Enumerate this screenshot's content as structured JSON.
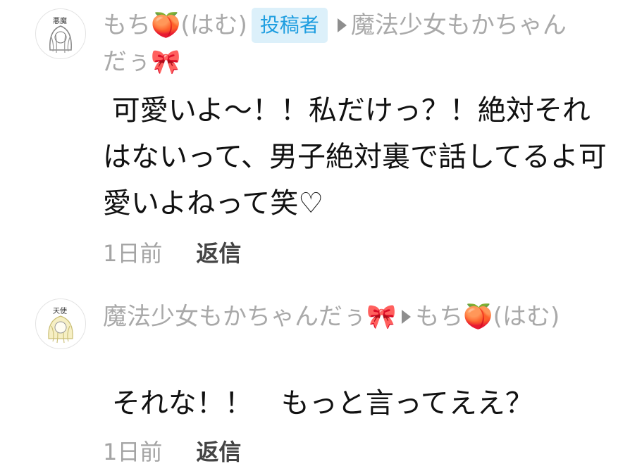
{
  "comments": [
    {
      "author": "もち🍑(はむ)",
      "badge": "投稿者",
      "reply_to": "魔法少女もかちゃんだぅ🎀",
      "avatar_tag": "悪魔",
      "avatar_hair_color": "#9a9a9a",
      "text": " 可愛いよ〜！！私だけっ？！絶対それはないって、男子絶対裏で話してるよ可愛いよねって笑♡",
      "time": "1日前",
      "reply_label": "返信"
    },
    {
      "author": "魔法少女もかちゃんだぅ🎀",
      "reply_to": "もち🍑(はむ)",
      "avatar_tag": "天使",
      "avatar_hair_color": "#efe39a",
      "text": " それな！！　もっと言ってええ？",
      "time": "1日前",
      "reply_label": "返信"
    }
  ]
}
